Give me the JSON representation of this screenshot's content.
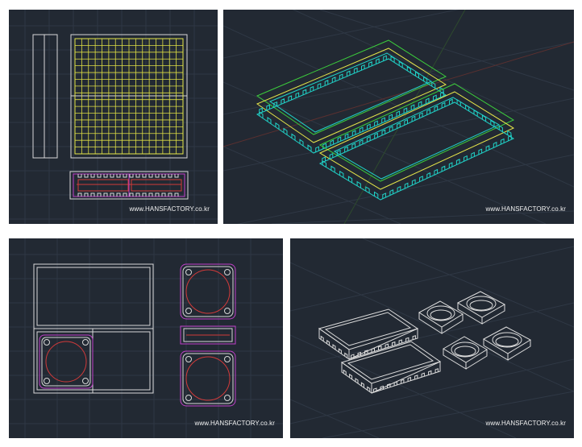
{
  "watermark": "www.HANSFACTORY.co.kr",
  "colors": {
    "background": "#222933",
    "grid": "#2f3845",
    "white": "#e6e6e6",
    "yellow": "#e6e64a",
    "red": "#d23a3a",
    "magenta": "#c040c8",
    "cyan": "#20d2c8",
    "green": "#3ccc3c"
  },
  "panels": {
    "top_left": {
      "watermark": "www.HANSFACTORY.co.kr"
    },
    "top_right": {
      "watermark": "www.HANSFACTORY.co.kr"
    },
    "bottom_left": {
      "watermark": "www.HANSFACTORY.co.kr"
    },
    "bottom_right": {
      "watermark": "www.HANSFACTORY.co.kr"
    }
  }
}
